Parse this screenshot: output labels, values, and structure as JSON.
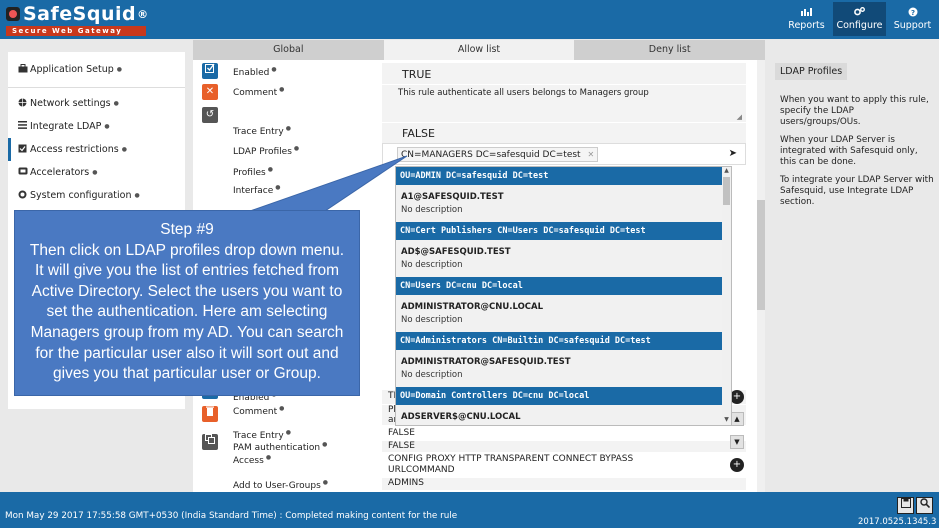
{
  "header": {
    "brand": "SafeSquid",
    "brand_mark": "®",
    "tagline": "Secure Web Gateway",
    "nav": [
      {
        "label": "Reports",
        "icon": "bar-chart-icon"
      },
      {
        "label": "Configure",
        "icon": "gears-icon"
      },
      {
        "label": "Support",
        "icon": "question-icon"
      }
    ]
  },
  "sidebar": {
    "app_setup": "Application Setup",
    "items": [
      {
        "label": "Network settings",
        "icon": "globe-icon"
      },
      {
        "label": "Integrate LDAP",
        "icon": "list-icon"
      },
      {
        "label": "Access restrictions",
        "icon": "checkbox-icon"
      },
      {
        "label": "Accelerators",
        "icon": "accelerator-icon"
      },
      {
        "label": "System configuration",
        "icon": "gear-icon"
      }
    ]
  },
  "tabs": [
    "Global",
    "Allow list",
    "Deny list"
  ],
  "rule_top": {
    "enabled_label": "Enabled",
    "enabled_value": "TRUE",
    "comment_label": "Comment",
    "comment_value": "This rule authenticate all users belongs to Managers group",
    "trace_label": "Trace Entry",
    "trace_value": "FALSE",
    "ldap_label": "LDAP Profiles",
    "ldap_chip": "CN=MANAGERS DC=safesquid DC=test",
    "profiles_label": "Profiles",
    "interface_label": "Interface"
  },
  "dropdown": {
    "groups": [
      {
        "header": "OU=ADMIN DC=safesquid DC=test",
        "entry": "A1@SAFESQUID.TEST",
        "desc": "No description"
      },
      {
        "header": "CN=Cert Publishers CN=Users DC=safesquid DC=test",
        "entry": "AD$@SAFESQUID.TEST",
        "desc": "No description"
      },
      {
        "header": "CN=Users DC=cnu DC=local",
        "entry": "ADMINISTRATOR@CNU.LOCAL",
        "desc": "No description"
      },
      {
        "header": "CN=Administrators CN=Builtin DC=safesquid DC=test",
        "entry": "ADMINISTRATOR@SAFESQUID.TEST",
        "desc": "No description"
      },
      {
        "header": "OU=Domain Controllers DC=cnu DC=local",
        "entry": "ADSERVER$@CNU.LOCAL",
        "desc": ""
      }
    ]
  },
  "rule_bottom": {
    "enabled_label": "Enabled",
    "enabled_value": "TI",
    "comment_label": "Comment",
    "comment_value_1": "Pl",
    "comment_value_2": "ar",
    "trace_label": "Trace Entry",
    "trace_value": "FALSE",
    "pam_label": "PAM authentication",
    "pam_value": "FALSE",
    "access_label": "Access",
    "access_line1": "CONFIG  PROXY  HTTP  TRANSPARENT  CONNECT  BYPASS",
    "access_line2": "URLCOMMAND",
    "add_groups_label": "Add to User-Groups",
    "add_groups_value": "ADMINS"
  },
  "help_panel": {
    "title": "LDAP Profiles",
    "p1": "When you want to apply this rule, specify the LDAP users/groups/OUs.",
    "p2": "When your LDAP Server is integrated with Safesquid only, this can be done.",
    "p3": "To integrate your LDAP Server with Safesquid, use Integrate LDAP section."
  },
  "callout": {
    "title": "Step #9",
    "body": "Then click on LDAP profiles drop down menu. It will give you the list of entries fetched from Active Directory. Select the users you want to set the authentication. Here am selecting Managers group from my AD. You can search for the particular user also it will sort out and gives you that particular user or Group."
  },
  "status": {
    "message": "Mon May 29 2017 17:55:58 GMT+0530 (India Standard Time) : Completed making content for the rule",
    "version": "2017.0525.1345.3"
  },
  "colors": {
    "brand_blue": "#1a6aa6",
    "callout_blue": "#4a79c2",
    "logo_red": "#c8381c",
    "delete_orange": "#e8602a"
  }
}
